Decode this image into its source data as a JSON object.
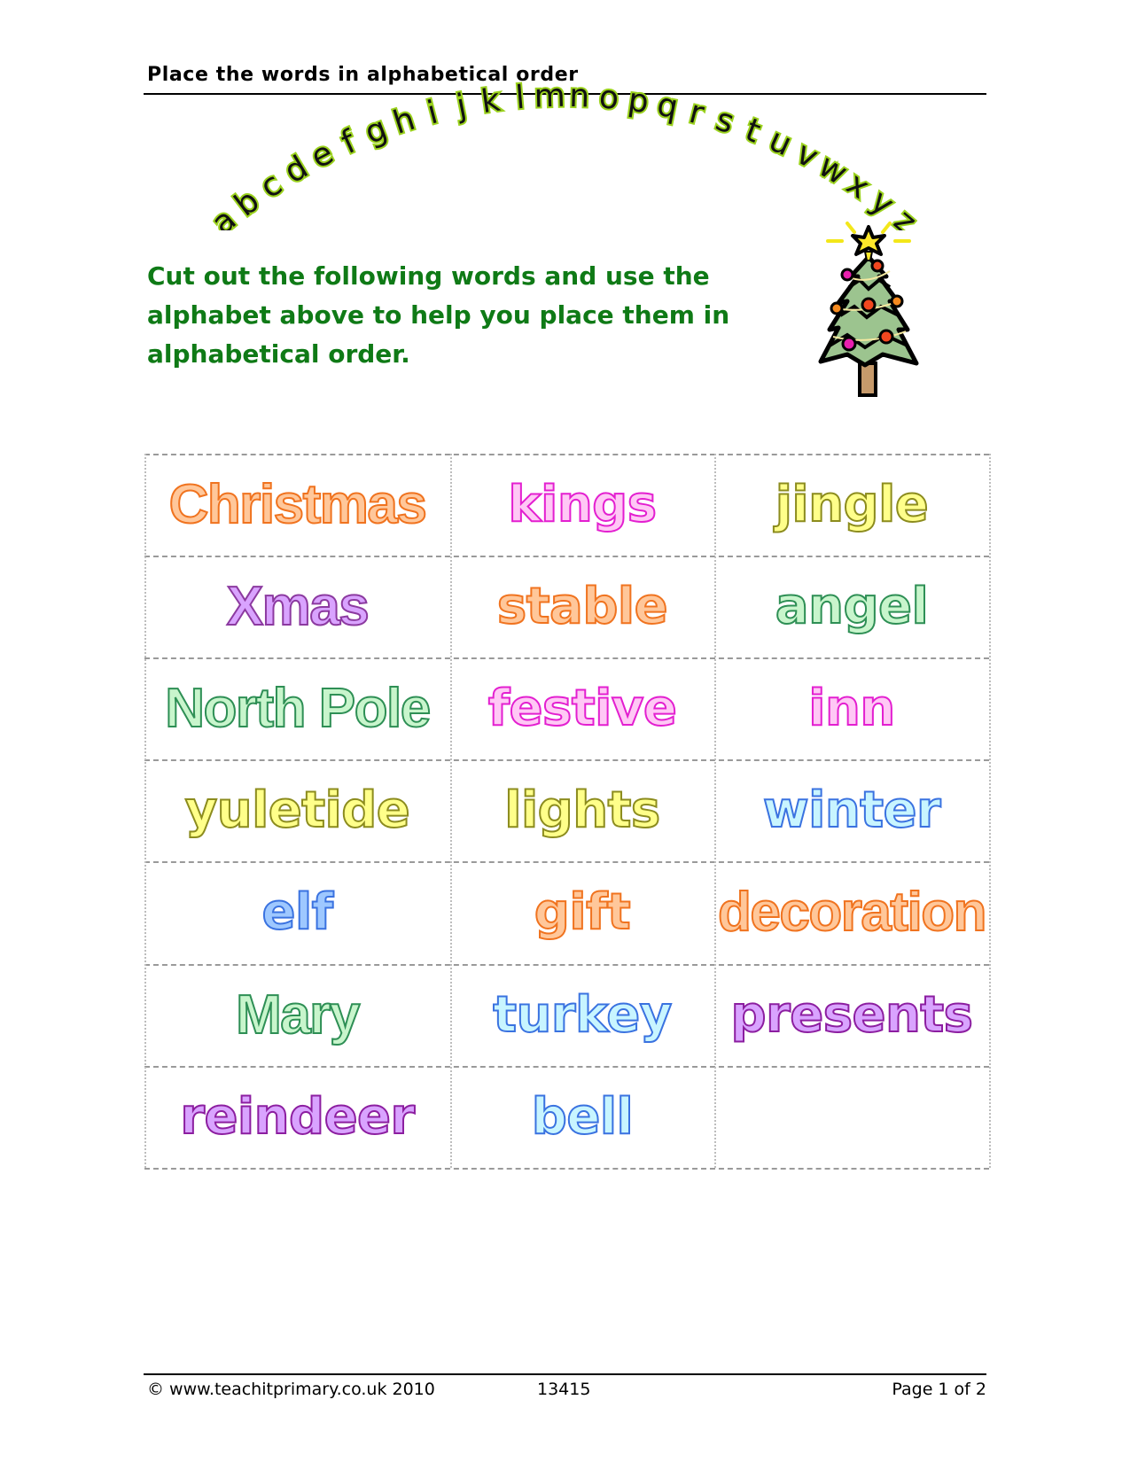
{
  "header": {
    "title": "Place the words in alphabetical order"
  },
  "alphabet": {
    "letters": [
      "a",
      "b",
      "c",
      "d",
      "e",
      "f",
      "g",
      "h",
      "i",
      "j",
      "k",
      "l",
      "m",
      "n",
      "o",
      "p",
      "q",
      "r",
      "s",
      "t",
      "u",
      "v",
      "w",
      "x",
      "y",
      "z"
    ]
  },
  "instructions": {
    "text": "Cut out the following words and use the alphabet above to help you place them in alphabetical order."
  },
  "illustration": {
    "icon": "christmas-tree-icon"
  },
  "cards": {
    "rows": [
      [
        {
          "word": "Christmas",
          "fill": "#ffc79a",
          "stroke": "#f0731f"
        },
        {
          "word": "kings",
          "fill": "#ffc8f5",
          "stroke": "#e31fd0"
        },
        {
          "word": "jingle",
          "fill": "#ffff8a",
          "stroke": "#8c8c1e"
        }
      ],
      [
        {
          "word": "Xmas",
          "fill": "#d9a3ff",
          "stroke": "#8c3aa0"
        },
        {
          "word": "stable",
          "fill": "#ffc79a",
          "stroke": "#f0731f"
        },
        {
          "word": "angel",
          "fill": "#c8f5cc",
          "stroke": "#2e8f55"
        }
      ],
      [
        {
          "word": "North Pole",
          "fill": "#c8f5cc",
          "stroke": "#2e8f55"
        },
        {
          "word": "festive",
          "fill": "#ffc8f5",
          "stroke": "#e31fd0"
        },
        {
          "word": "inn",
          "fill": "#ffc8f5",
          "stroke": "#e31fd0"
        }
      ],
      [
        {
          "word": "yuletide",
          "fill": "#ffff8a",
          "stroke": "#8c8c1e"
        },
        {
          "word": "lights",
          "fill": "#ffff8a",
          "stroke": "#8c8c1e"
        },
        {
          "word": "winter",
          "fill": "#c8f5ff",
          "stroke": "#3a72e0"
        }
      ],
      [
        {
          "word": "elf",
          "fill": "#9ec8ff",
          "stroke": "#3a72e0"
        },
        {
          "word": "gift",
          "fill": "#ffc79a",
          "stroke": "#f0731f"
        },
        {
          "word": "decoration",
          "fill": "#ffc79a",
          "stroke": "#f0731f"
        }
      ],
      [
        {
          "word": "Mary",
          "fill": "#c8f5cc",
          "stroke": "#2e8f55"
        },
        {
          "word": "turkey",
          "fill": "#c8f5ff",
          "stroke": "#3a72e0"
        },
        {
          "word": "presents",
          "fill": "#d9a3ff",
          "stroke": "#8c1ea0"
        }
      ],
      [
        {
          "word": "reindeer",
          "fill": "#d9a3ff",
          "stroke": "#8c1ea0"
        },
        {
          "word": "bell",
          "fill": "#c8f5ff",
          "stroke": "#3a72e0"
        },
        {
          "word": "",
          "fill": "#ffffff",
          "stroke": "#ffffff"
        }
      ]
    ]
  },
  "footer": {
    "copyright": "© www.teachitprimary.co.uk 2010",
    "code": "13415",
    "page": "Page 1 of 2"
  },
  "colors": {
    "instructions": "#0f7a16",
    "alphabet_glow": "#9bd21e",
    "cut_lines": "#9a9a9a"
  }
}
